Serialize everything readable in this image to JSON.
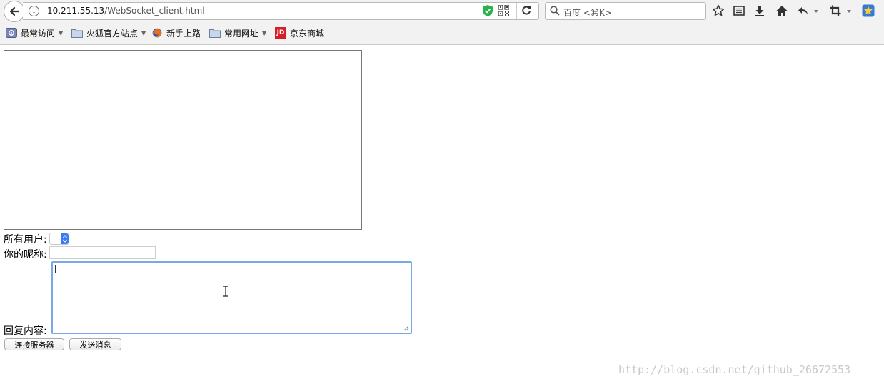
{
  "browser": {
    "url_host": "10.211.55.13",
    "url_path": "/WebSocket_client.html",
    "search_placeholder": "百度 <⌘K>"
  },
  "bookmarks": [
    {
      "label": "最常访问",
      "icon": "gear-icon",
      "has_dropdown": true
    },
    {
      "label": "火狐官方站点",
      "icon": "folder-icon",
      "has_dropdown": true
    },
    {
      "label": "新手上路",
      "icon": "firefox-icon",
      "has_dropdown": false
    },
    {
      "label": "常用网址",
      "icon": "folder-icon",
      "has_dropdown": true
    },
    {
      "label": "京东商城",
      "icon": "jd-logo-icon",
      "has_dropdown": false
    }
  ],
  "jd_logo_text": "JD",
  "form": {
    "all_users_label": "所有用户:",
    "nickname_label": "你的昵称:",
    "nickname_value": "",
    "reply_label": "回复内容:",
    "reply_value": "",
    "connect_button": "连接服务器",
    "send_button": "发送消息"
  },
  "watermark": "http://blog.csdn.net/github_26672553",
  "colors": {
    "focus_border": "#7aa7ea",
    "select_accent": "#3b7cf0",
    "shield_green": "#2bb24c",
    "jd_red": "#d51f26"
  }
}
